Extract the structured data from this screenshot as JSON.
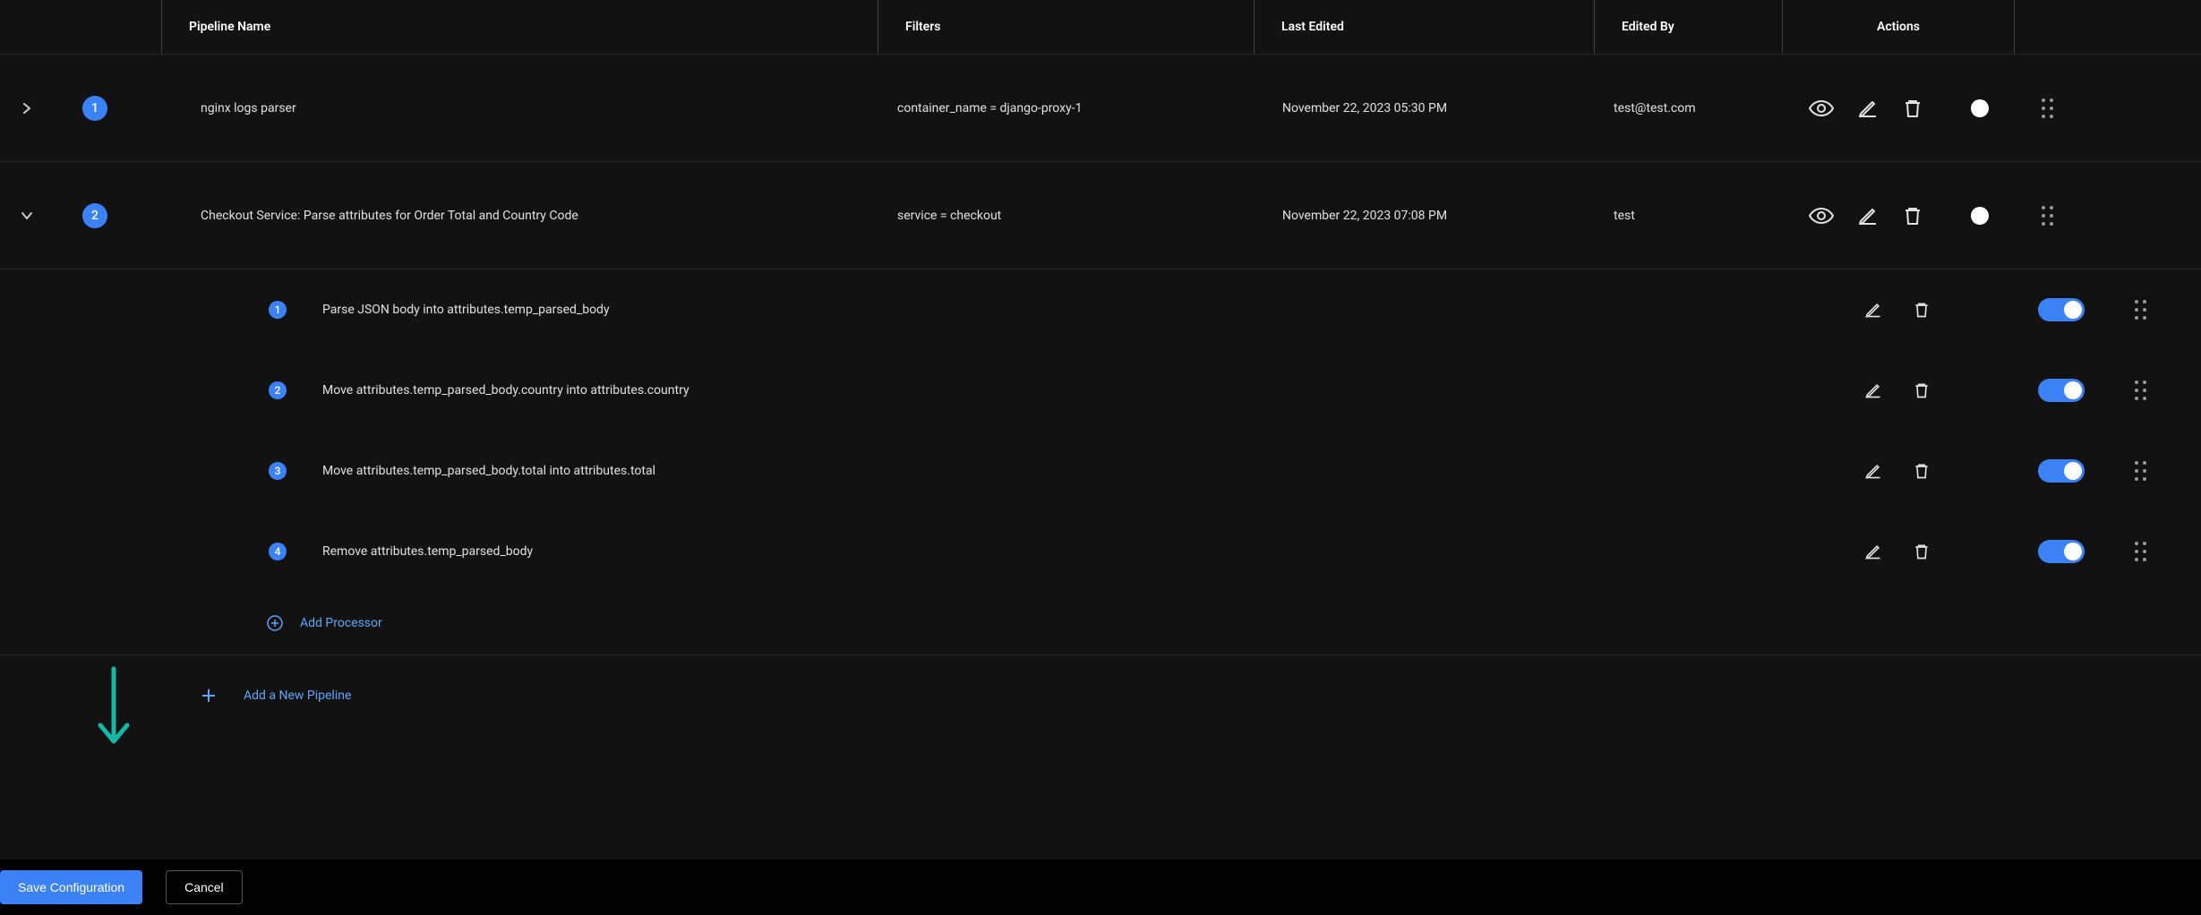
{
  "columns": {
    "name": "Pipeline Name",
    "filters": "Filters",
    "last_edited": "Last Edited",
    "edited_by": "Edited By",
    "actions": "Actions"
  },
  "pipelines": [
    {
      "index": "1",
      "name": "nginx logs parser",
      "filter": "container_name = django-proxy-1",
      "last_edited": "November 22, 2023 05:30 PM",
      "edited_by": "test@test.com",
      "expanded": false
    },
    {
      "index": "2",
      "name": "Checkout Service: Parse attributes for Order Total and Country Code",
      "filter": "service = checkout",
      "last_edited": "November 22, 2023 07:08 PM",
      "edited_by": "test",
      "expanded": true,
      "processors": [
        {
          "index": "1",
          "name": "Parse JSON body into attributes.temp_parsed_body"
        },
        {
          "index": "2",
          "name": "Move attributes.temp_parsed_body.country into attributes.country"
        },
        {
          "index": "3",
          "name": "Move attributes.temp_parsed_body.total into attributes.total"
        },
        {
          "index": "4",
          "name": "Remove attributes.temp_parsed_body"
        }
      ]
    }
  ],
  "add_processor_label": "Add Processor",
  "add_pipeline_label": "Add a New Pipeline",
  "save_label": "Save Configuration",
  "cancel_label": "Cancel"
}
